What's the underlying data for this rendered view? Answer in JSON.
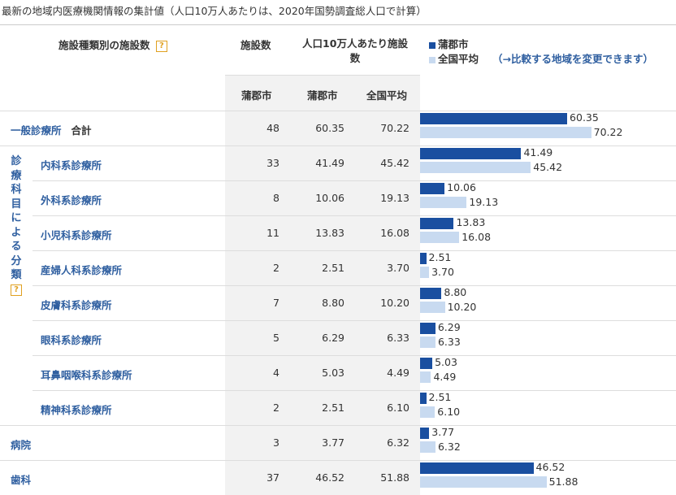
{
  "caption": "最新の地域内医療機関情報の集計値（人口10万人あたりは、2020年国勢調査総人口で計算）",
  "header": {
    "category_label": "施設種類別の施設数",
    "help_icon": "?",
    "count_label": "施設数",
    "per100k_label": "人口10万人あたり施設数",
    "sub_city1": "蒲郡市",
    "sub_city2": "蒲郡市",
    "sub_national": "全国平均"
  },
  "legend": {
    "city": "蒲郡市",
    "national": "全国平均",
    "change_link": "（→比較する地域を変更できます）",
    "colors": {
      "city": "#1a4fa0",
      "national": "#c8daf0"
    }
  },
  "group_label": "診療科目による分類",
  "bar_scale_max": 100,
  "rows": [
    {
      "name": "一般診療所",
      "suffix": "合計",
      "count": "48",
      "city": "60.35",
      "national": "70.22",
      "city_val": 60.35,
      "national_val": 70.22
    },
    {
      "name": "内科系診療所",
      "count": "33",
      "city": "41.49",
      "national": "45.42",
      "city_val": 41.49,
      "national_val": 45.42
    },
    {
      "name": "外科系診療所",
      "count": "8",
      "city": "10.06",
      "national": "19.13",
      "city_val": 10.06,
      "national_val": 19.13
    },
    {
      "name": "小児科系診療所",
      "count": "11",
      "city": "13.83",
      "national": "16.08",
      "city_val": 13.83,
      "national_val": 16.08
    },
    {
      "name": "産婦人科系診療所",
      "count": "2",
      "city": "2.51",
      "national": "3.70",
      "city_val": 2.51,
      "national_val": 3.7
    },
    {
      "name": "皮膚科系診療所",
      "count": "7",
      "city": "8.80",
      "national": "10.20",
      "city_val": 8.8,
      "national_val": 10.2
    },
    {
      "name": "眼科系診療所",
      "count": "5",
      "city": "6.29",
      "national": "6.33",
      "city_val": 6.29,
      "national_val": 6.33
    },
    {
      "name": "耳鼻咽喉科系診療所",
      "count": "4",
      "city": "5.03",
      "national": "4.49",
      "city_val": 5.03,
      "national_val": 4.49
    },
    {
      "name": "精神科系診療所",
      "count": "2",
      "city": "2.51",
      "national": "6.10",
      "city_val": 2.51,
      "national_val": 6.1
    },
    {
      "name": "病院",
      "count": "3",
      "city": "3.77",
      "national": "6.32",
      "city_val": 3.77,
      "national_val": 6.32
    },
    {
      "name": "歯科",
      "count": "37",
      "city": "46.52",
      "national": "51.88",
      "city_val": 46.52,
      "national_val": 51.88
    }
  ]
}
